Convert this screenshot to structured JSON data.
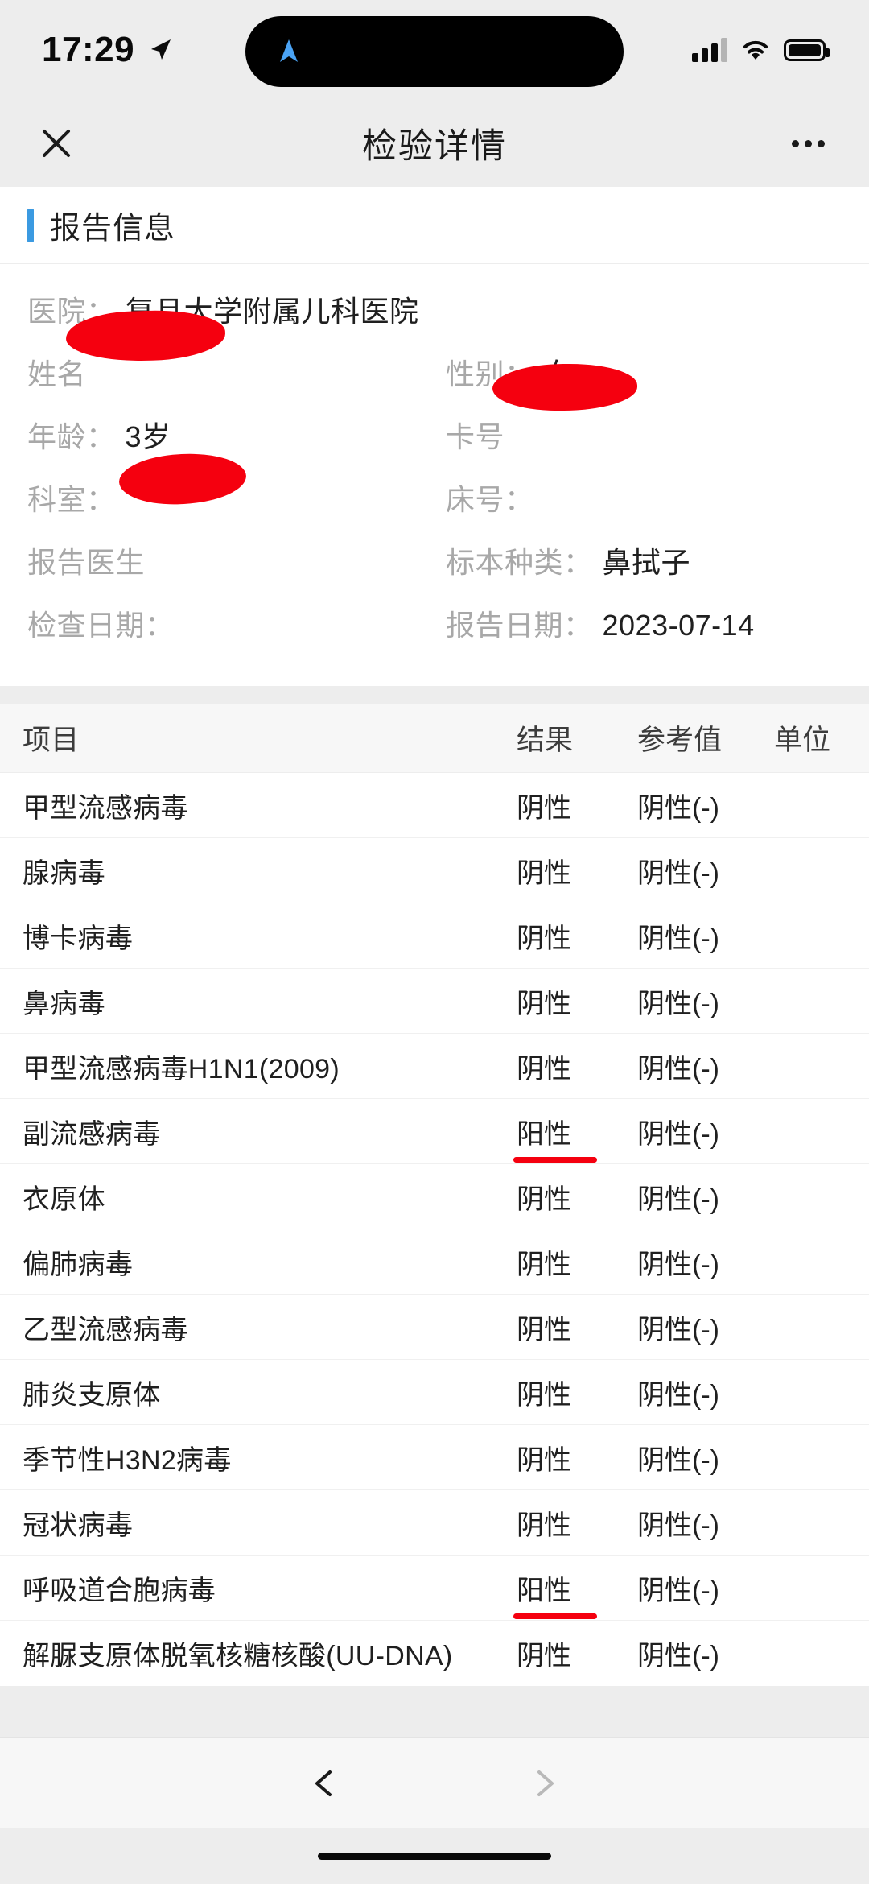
{
  "status_bar": {
    "time": "17:29",
    "location_icon": "location-arrow-icon",
    "island_icon": "navigation-arrow-icon",
    "signal_icon": "cellular-signal-icon",
    "wifi_icon": "wifi-icon",
    "battery_icon": "battery-full-icon"
  },
  "nav": {
    "close_icon": "close-icon",
    "title": "检验详情",
    "more_icon": "more-options-icon"
  },
  "report_section": {
    "title": "报告信息",
    "accent_color": "#3b9ae1",
    "fields": {
      "hospital_label": "医院：",
      "hospital_value": "复旦大学附属儿科医院",
      "name_label": "姓名",
      "name_value": "",
      "gender_label": "性别：",
      "gender_value": "女",
      "age_label": "年龄：",
      "age_value": "3岁",
      "card_label": "卡号",
      "card_value": "",
      "department_label": "科室：",
      "department_value": "",
      "bed_label": "床号：",
      "bed_value": "",
      "doctor_label": "报告医生",
      "doctor_value": "",
      "specimen_label": "标本种类：",
      "specimen_value": "鼻拭子",
      "exam_date_label": "检查日期：",
      "exam_date_value": "",
      "report_date_label": "报告日期：",
      "report_date_value": "2023-07-14"
    }
  },
  "results_table": {
    "headers": {
      "item": "项目",
      "result": "结果",
      "reference": "参考值",
      "unit": "单位"
    },
    "positive_color": "#f5000f",
    "rows": [
      {
        "item": "甲型流感病毒",
        "result": "阴性",
        "reference": "阴性(-)",
        "unit": "",
        "positive": false
      },
      {
        "item": "腺病毒",
        "result": "阴性",
        "reference": "阴性(-)",
        "unit": "",
        "positive": false
      },
      {
        "item": "博卡病毒",
        "result": "阴性",
        "reference": "阴性(-)",
        "unit": "",
        "positive": false
      },
      {
        "item": "鼻病毒",
        "result": "阴性",
        "reference": "阴性(-)",
        "unit": "",
        "positive": false
      },
      {
        "item": "甲型流感病毒H1N1(2009)",
        "result": "阴性",
        "reference": "阴性(-)",
        "unit": "",
        "positive": false
      },
      {
        "item": "副流感病毒",
        "result": "阳性",
        "reference": "阴性(-)",
        "unit": "",
        "positive": true
      },
      {
        "item": "衣原体",
        "result": "阴性",
        "reference": "阴性(-)",
        "unit": "",
        "positive": false
      },
      {
        "item": "偏肺病毒",
        "result": "阴性",
        "reference": "阴性(-)",
        "unit": "",
        "positive": false
      },
      {
        "item": "乙型流感病毒",
        "result": "阴性",
        "reference": "阴性(-)",
        "unit": "",
        "positive": false
      },
      {
        "item": "肺炎支原体",
        "result": "阴性",
        "reference": "阴性(-)",
        "unit": "",
        "positive": false
      },
      {
        "item": "季节性H3N2病毒",
        "result": "阴性",
        "reference": "阴性(-)",
        "unit": "",
        "positive": false
      },
      {
        "item": "冠状病毒",
        "result": "阴性",
        "reference": "阴性(-)",
        "unit": "",
        "positive": false
      },
      {
        "item": "呼吸道合胞病毒",
        "result": "阳性",
        "reference": "阴性(-)",
        "unit": "",
        "positive": true
      },
      {
        "item": "解脲支原体脱氧核糖核酸(UU-DNA)",
        "result": "阴性",
        "reference": "阴性(-)",
        "unit": "",
        "positive": false
      }
    ]
  },
  "pager": {
    "prev_icon": "chevron-left-icon",
    "next_icon": "chevron-right-icon"
  }
}
